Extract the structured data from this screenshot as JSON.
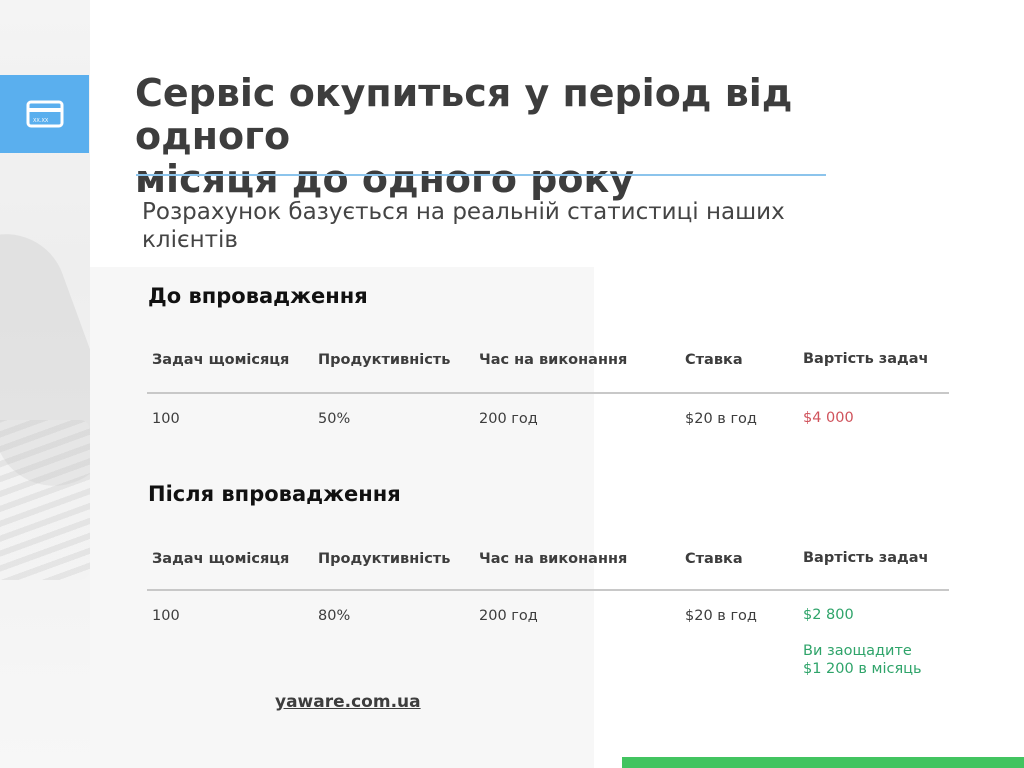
{
  "header": {
    "title_line1": "Сервіс окупиться у період від одного",
    "title_line2": "місяця до одного року",
    "subtitle_line1": "Розрахунок базується на реальній статистиці наших",
    "subtitle_line2": "клієнтів",
    "icon": "credit-card-icon",
    "card_text": "XX.XX"
  },
  "columns": [
    "Задач щомісяця",
    "Продуктивність",
    "Час на виконання",
    "Ставка",
    "Вартість задач"
  ],
  "before": {
    "title": "До впровадження",
    "row": [
      "100",
      "50%",
      "200 год",
      "$20 в год",
      "$4 000"
    ]
  },
  "after": {
    "title": "Після впровадження",
    "row": [
      "100",
      "80%",
      "200 год",
      "$20 в год",
      "$2 800"
    ],
    "savings_line1": "Ви заощадите",
    "savings_line2": "$1 200 в місяць"
  },
  "footer": {
    "link": "yaware.com.ua"
  },
  "colors": {
    "accent_blue": "#5aafee",
    "cost_red": "#d0535c",
    "savings_green": "#2fa46a",
    "bar_green": "#42c460"
  }
}
